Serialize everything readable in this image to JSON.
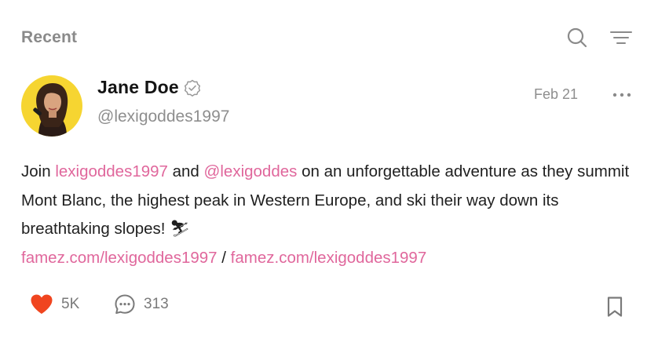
{
  "header": {
    "title": "Recent",
    "search_icon": "search-icon",
    "filter_icon": "filter-icon"
  },
  "post": {
    "author": {
      "name": "Jane Doe",
      "handle": "@lexigoddes1997",
      "verified": true,
      "avatar_bg": "#f6d531"
    },
    "date": "Feb 21",
    "text": {
      "prefix": "Join ",
      "link1": "lexigoddes1997",
      "mid1": " and ",
      "link2": "@lexigoddes",
      "rest": " on an unforgettable adventure as they summit Mont Blanc, the highest peak in Western Europe, and ski their way down its breathtaking slopes! ",
      "emoji": "⛷",
      "url1": "famez.com/lexigoddes1997",
      "separator": " / ",
      "url2": "famez.com/lexigoddes1997"
    },
    "likes": "5K",
    "comments": "313",
    "liked": true
  },
  "colors": {
    "link": "#e0679c",
    "heart": "#f0451f",
    "muted": "#8e8e8e"
  }
}
